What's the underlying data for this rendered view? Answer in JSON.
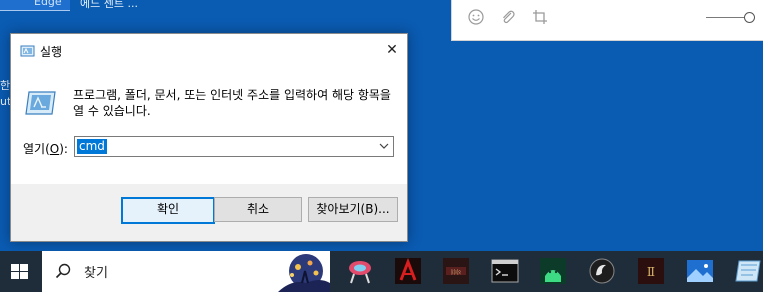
{
  "desktop": {
    "top_left_label": "Edge",
    "top_left_text": "에드 센트 ...",
    "side_text_1": "한",
    "side_text_2": "ut"
  },
  "sticky_note": {
    "icons": [
      "emoji-icon",
      "attachment-icon",
      "crop-icon"
    ]
  },
  "run_dialog": {
    "title": "실행",
    "description": "프로그램, 폴더, 문서, 또는 인터넷 주소를 입력하여 해당 항목을 열 수 있습니다.",
    "open_label_prefix": "열기(",
    "open_label_key": "O",
    "open_label_suffix": "):",
    "input_value": "cmd",
    "ok_label": "확인",
    "cancel_label": "취소",
    "browse_label": "찾아보기(B)..."
  },
  "taskbar": {
    "search_placeholder": "찾기",
    "apps": [
      "snipping-icon",
      "adobe-icon",
      "bdo-icon",
      "terminal-icon",
      "android-icon",
      "obs-icon",
      "diablo-icon",
      "photos-icon",
      "sticky-notes-icon"
    ]
  },
  "colors": {
    "desktop": "#0a5bb2",
    "accent": "#0078d7",
    "taskbar": "#1f2d3b"
  }
}
